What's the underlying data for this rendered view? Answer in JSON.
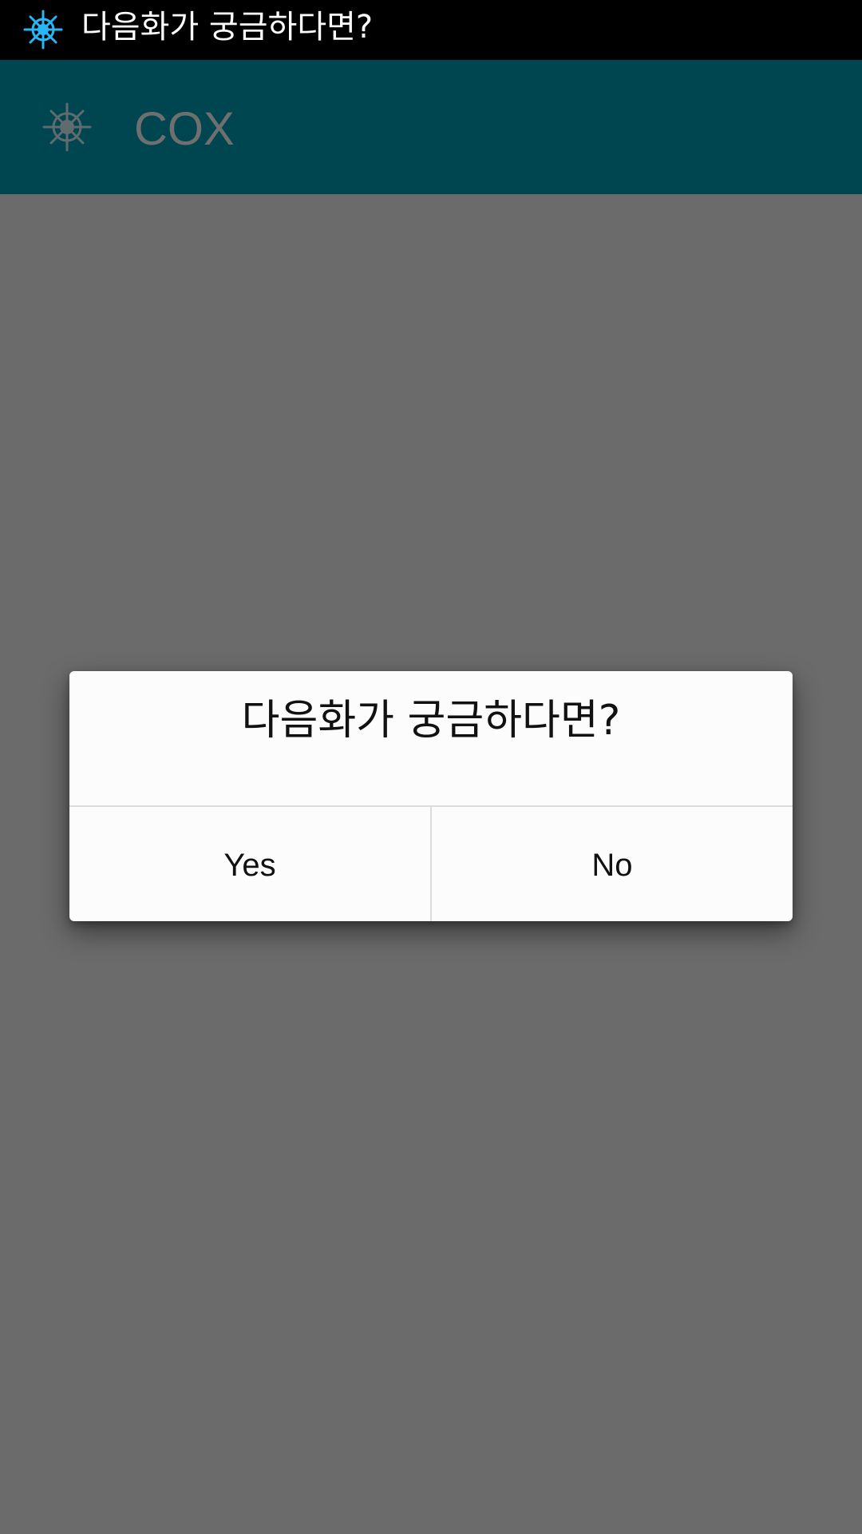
{
  "status_bar": {
    "icon": "ship-wheel-icon",
    "icon_color": "#29b6f6",
    "text": "다음화가 궁금하다면?"
  },
  "app_bar": {
    "icon": "ship-wheel-icon",
    "title": "COX",
    "background": "#004650"
  },
  "dialog": {
    "title": "다음화가 궁금하다면?",
    "yes_label": "Yes",
    "no_label": "No"
  }
}
